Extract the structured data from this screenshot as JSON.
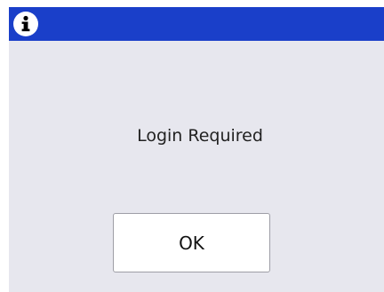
{
  "dialog": {
    "icon": "info-icon",
    "title_bar_color": "#1a3fc9",
    "message": "Login Required",
    "ok_label": "OK"
  }
}
